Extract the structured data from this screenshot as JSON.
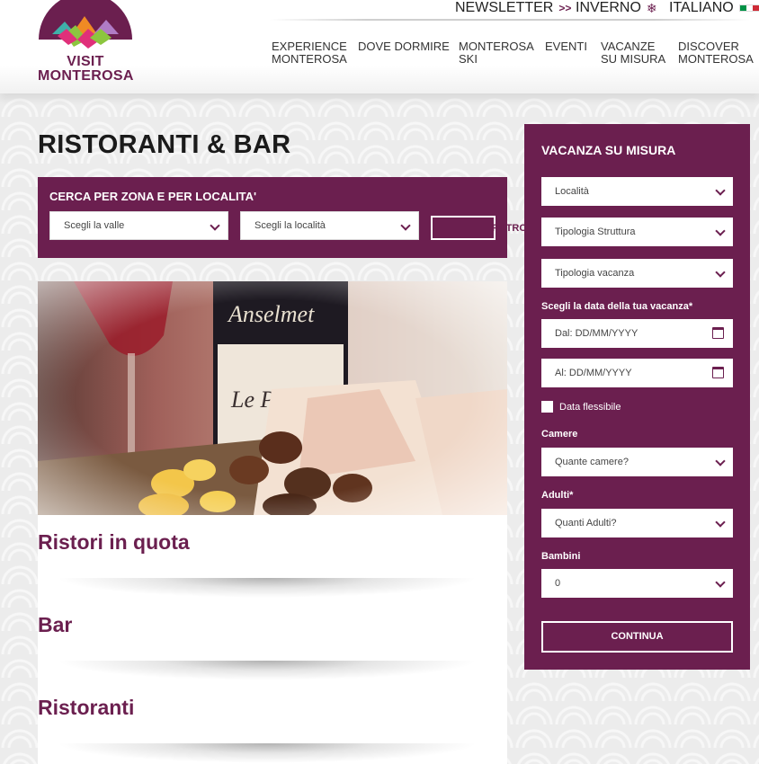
{
  "brand": {
    "line1": "VISIT",
    "line2": "MONTEROSA",
    "colors": {
      "primary": "#6b1f4f",
      "teal": "#3fb0a9",
      "pink": "#e0307a",
      "green": "#8cc63f",
      "lilac": "#b07cc6",
      "orange": "#f08a24"
    }
  },
  "topbar": {
    "newsletter": "NEWSLETTER",
    "newsletter_icon": "double-chevron-right-icon",
    "season": "INVERNO",
    "season_icon": "snowflake-icon",
    "language": "ITALIANO",
    "language_icon": "italy-flag-icon"
  },
  "nav": [
    {
      "label": "EXPERIENCE\nMONTEROSA"
    },
    {
      "label": "DOVE DORMIRE"
    },
    {
      "label": "MONTEROSA\nSKI"
    },
    {
      "label": "EVENTI"
    },
    {
      "label": "VACANZE\nSU MISURA"
    },
    {
      "label": "DISCOVER\nMONTEROSA"
    }
  ],
  "main": {
    "title": "RISTORANTI & BAR",
    "search": {
      "title": "CERCA PER ZONA E PER LOCALITA'",
      "valle_placeholder": "Scegli la valle",
      "localita_placeholder": "Scegli la località",
      "filter_label": "FILTRO"
    },
    "hero_alt": "wine-and-food-photo",
    "categories": [
      {
        "label": "Ristori in quota"
      },
      {
        "label": "Bar"
      },
      {
        "label": "Ristoranti"
      }
    ]
  },
  "sidebar": {
    "title": "VACANZA SU MISURA",
    "localita": "Località",
    "tipologia_struttura": "Tipologia Struttura",
    "tipologia_vacanza": "Tipologia vacanza",
    "date_label": "Scegli la data della tua vacanza*",
    "dal": "Dal: DD/MM/YYYY",
    "al": "Al: DD/MM/YYYY",
    "flessibile": "Data flessibile",
    "camere_label": "Camere",
    "camere_placeholder": "Quante camere?",
    "adulti_label": "Adulti*",
    "adulti_placeholder": "Quanti Adulti?",
    "bambini_label": "Bambini",
    "bambini_value": "0",
    "continua": "CONTINUA"
  }
}
